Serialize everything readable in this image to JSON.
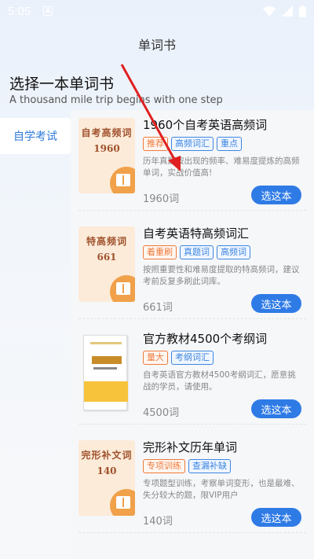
{
  "status_bar": {
    "time": "5:05",
    "notif_glyph": "A"
  },
  "header": {
    "title": "单词书"
  },
  "page": {
    "heading": "选择一本单词书",
    "subheading": "A thousand mile trip begins with one step"
  },
  "sidebar": {
    "items": [
      {
        "label": "自学考试"
      }
    ]
  },
  "books": [
    {
      "cover_title": "自考高频词",
      "cover_num": "1960",
      "name": "1960个自考英语高频词",
      "tags": [
        {
          "label": "推荐",
          "color": "orange"
        },
        {
          "label": "高频词汇",
          "color": "blue"
        },
        {
          "label": "重点",
          "color": "blue"
        }
      ],
      "desc": "历年真题按出现的频率、难易度提炼的高频单词，实战价值高!",
      "count": "1960词",
      "button": "选这本"
    },
    {
      "cover_title": "特高频词",
      "cover_num": "661",
      "name": "自考英语特高频词汇",
      "tags": [
        {
          "label": "着重刷",
          "color": "orange"
        },
        {
          "label": "真题词",
          "color": "blue"
        },
        {
          "label": "高频词",
          "color": "blue"
        }
      ],
      "desc": "按照重要性和难易度提取的特高频词，建议考前反复多刷此词库。",
      "count": "661词",
      "button": "选这本"
    },
    {
      "cover_title": "",
      "cover_num": "",
      "name": "官方教材4500个考纲词",
      "tags": [
        {
          "label": "量大",
          "color": "orange"
        },
        {
          "label": "考纲词汇",
          "color": "blue"
        }
      ],
      "desc": "自考英语官方教材4500考纲词汇，愿意挑战的学员，请使用。",
      "count": "4500词",
      "button": "选这本"
    },
    {
      "cover_title": "完形补文词",
      "cover_num": "140",
      "name": "完形补文历年单词",
      "tags": [
        {
          "label": "专项训练",
          "color": "orange"
        },
        {
          "label": "查漏补缺",
          "color": "blue"
        }
      ],
      "desc": "专项题型训练，考察单词变形，也是最难、失分较大的题，限VIP用户",
      "count": "140词",
      "button": "选这本"
    }
  ],
  "colors": {
    "accent": "#2f7be6",
    "tag_orange": "#ef7a3b",
    "tag_blue": "#3d86e0",
    "annotation_arrow": "#e02020"
  }
}
